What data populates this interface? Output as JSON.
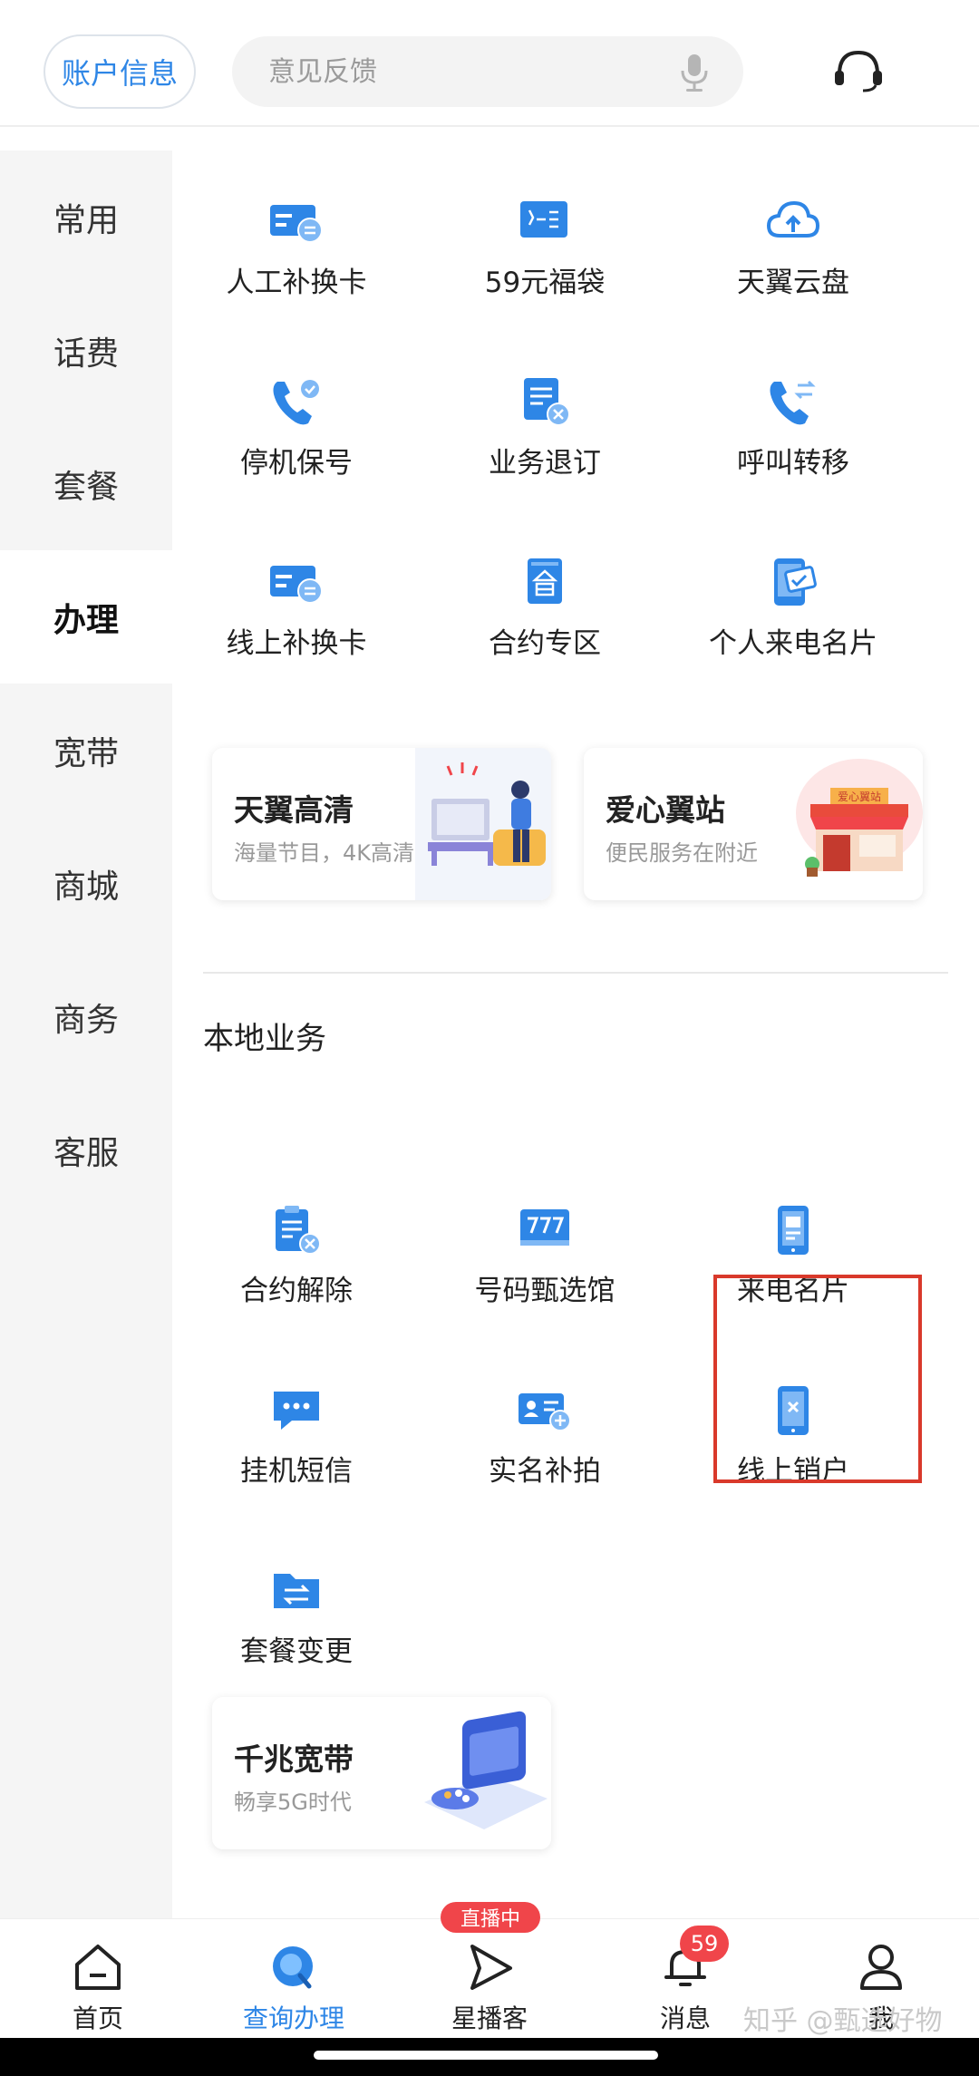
{
  "header": {
    "account_label": "账户信息",
    "search_placeholder": "意见反馈",
    "mic_icon": "microphone-icon",
    "service_icon": "headset-icon"
  },
  "sidebar": {
    "items": [
      {
        "label": "常用",
        "active": false
      },
      {
        "label": "话费",
        "active": false
      },
      {
        "label": "套餐",
        "active": false
      },
      {
        "label": "办理",
        "active": true
      },
      {
        "label": "宽带",
        "active": false
      },
      {
        "label": "商城",
        "active": false
      },
      {
        "label": "商务",
        "active": false
      },
      {
        "label": "客服",
        "active": false
      }
    ]
  },
  "main": {
    "services": [
      {
        "label": "人工补换卡",
        "icon": "sim-card-swap-icon"
      },
      {
        "label": "59元福袋",
        "icon": "star-card-icon"
      },
      {
        "label": "天翼云盘",
        "icon": "cloud-upload-icon"
      },
      {
        "label": "停机保号",
        "icon": "phone-check-icon"
      },
      {
        "label": "业务退订",
        "icon": "document-cancel-icon"
      },
      {
        "label": "呼叫转移",
        "icon": "phone-forward-icon"
      },
      {
        "label": "线上补换卡",
        "icon": "sim-card-swap-icon"
      },
      {
        "label": "合约专区",
        "icon": "contract-book-icon"
      },
      {
        "label": "个人来电名片",
        "icon": "phone-card-icon"
      }
    ],
    "banners": [
      {
        "title": "天翼高清",
        "subtitle": "海量节目，4K高清"
      },
      {
        "title": "爱心翼站",
        "subtitle": "便民服务在附近",
        "art_text": "爱心翼站"
      }
    ],
    "local_section_title": "本地业务",
    "local_services": [
      {
        "label": "合约解除",
        "icon": "clipboard-cancel-icon"
      },
      {
        "label": "号码甄选馆",
        "icon": "number-777-icon"
      },
      {
        "label": "来电名片",
        "icon": "mobile-card-icon"
      },
      {
        "label": "挂机短信",
        "icon": "chat-bubble-icon"
      },
      {
        "label": "实名补拍",
        "icon": "id-card-add-icon"
      },
      {
        "label": "线上销户",
        "icon": "mobile-close-icon"
      },
      {
        "label": "套餐变更",
        "icon": "folder-swap-icon"
      }
    ],
    "broadband_banner": {
      "title": "千兆宽带",
      "subtitle": "畅享5G时代"
    }
  },
  "bottom_nav": {
    "items": [
      {
        "label": "首页",
        "icon": "home-icon",
        "active": false
      },
      {
        "label": "查询办理",
        "icon": "search-query-icon",
        "active": true
      },
      {
        "label": "星播客",
        "icon": "play-triangle-icon",
        "active": false
      },
      {
        "label": "消息",
        "icon": "bell-icon",
        "active": false
      },
      {
        "label": "我",
        "icon": "user-icon",
        "active": false
      }
    ],
    "live_badge": "直播中",
    "message_count": "59"
  },
  "watermark": "知乎 @甄选好物",
  "colors": {
    "accent": "#2e86e6",
    "badge": "#f0454a",
    "highlight": "#d9392b"
  }
}
